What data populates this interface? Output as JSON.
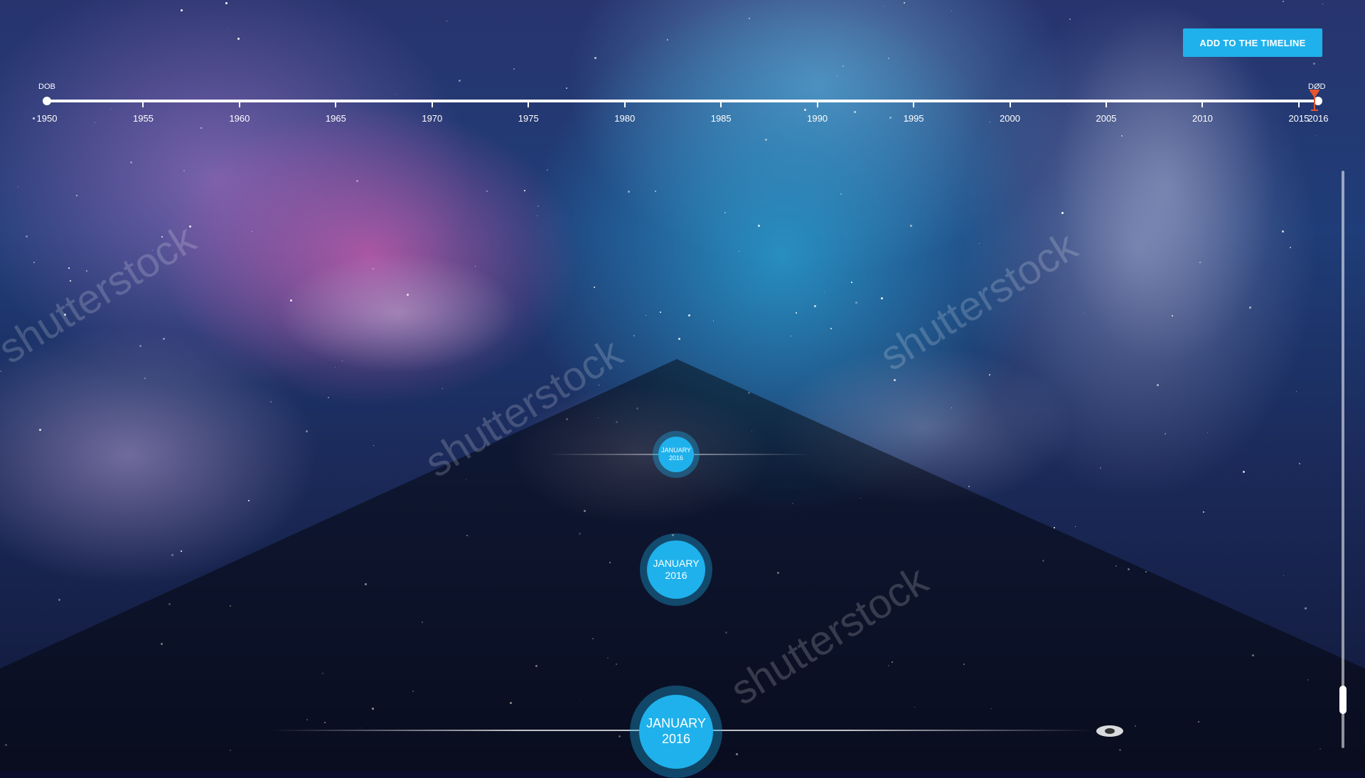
{
  "toolbar": {
    "add_label": "ADD TO THE TIMELINE"
  },
  "timeline": {
    "start_label": "DOB",
    "end_label": "DØD",
    "start_year": 1950,
    "end_year": 2016,
    "ticks": [
      "1955",
      "1960",
      "1965",
      "1970",
      "1975",
      "1980",
      "1985",
      "1990",
      "1995",
      "2000",
      "2005",
      "2010",
      "2015"
    ],
    "marker_year": 2015.8,
    "marker_color": "#e8542d"
  },
  "events": [
    {
      "month": "JANUARY",
      "year": "2016",
      "size": "small"
    },
    {
      "month": "JANUARY",
      "year": "2016",
      "size": "medium"
    },
    {
      "month": "JANUARY",
      "year": "2016",
      "size": "large"
    }
  ],
  "watermark": "shutterstock",
  "accent_color": "#1fb1ec"
}
